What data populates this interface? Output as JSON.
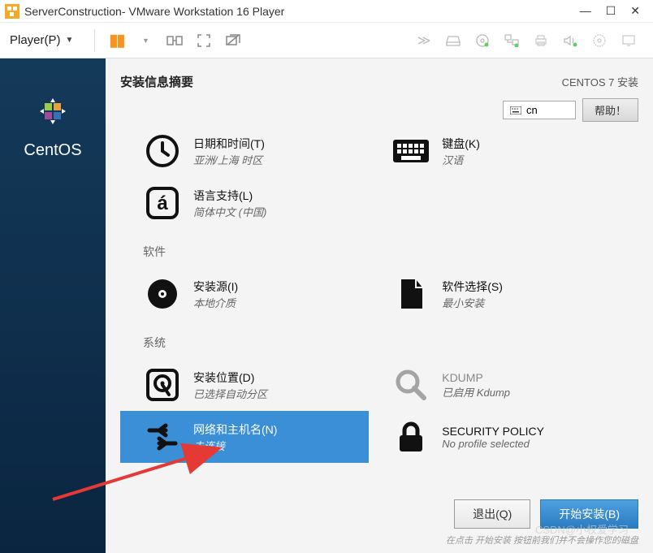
{
  "window": {
    "title": "ServerConstruction- VMware Workstation 16 Player",
    "player_menu": "Player(P)"
  },
  "installer": {
    "summary_title": "安装信息摘要",
    "install_label": "CENTOS 7 安装",
    "lang_indicator": "cn",
    "help_btn": "帮助！",
    "sections": {
      "localization_items": [
        {
          "label": "日期和时间(T)",
          "sub": "亚洲/上海 时区",
          "icon": "clock"
        },
        {
          "label": "键盘(K)",
          "sub": "汉语",
          "icon": "keyboard"
        },
        {
          "label": "语言支持(L)",
          "sub": "简体中文 (中国)",
          "icon": "lang"
        }
      ],
      "software_title": "软件",
      "software_items": [
        {
          "label": "安装源(I)",
          "sub": "本地介质",
          "icon": "disc"
        },
        {
          "label": "软件选择(S)",
          "sub": "最小安装",
          "icon": "package"
        }
      ],
      "system_title": "系统",
      "system_items": [
        {
          "label": "安装位置(D)",
          "sub": "已选择自动分区",
          "icon": "disk"
        },
        {
          "label": "KDUMP",
          "sub": "已启用 Kdump",
          "icon": "wrench",
          "disabled": true
        },
        {
          "label": "网络和主机名(N)",
          "sub": "未连接",
          "icon": "network",
          "selected": true
        },
        {
          "label": "SECURITY POLICY",
          "sub": "No profile selected",
          "icon": "lock"
        }
      ]
    },
    "footer": {
      "quit": "退出(Q)",
      "begin": "开始安装(B)",
      "hint": "在点击 开始安装 按钮前我们并不会操作您的磁盘"
    }
  },
  "sidebar": {
    "brand": "CentOS"
  },
  "watermark": "CSDN@小权爱学习"
}
